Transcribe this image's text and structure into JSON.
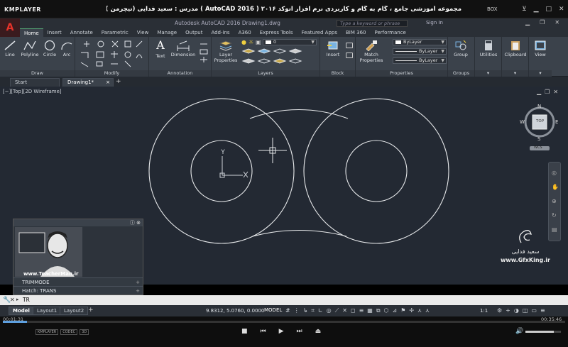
{
  "player": {
    "logo": "KMPLAYER",
    "title": "مجموعه آموزشی جامع ، گام به گام و کاربردی نرم افزار   اتوکد ۲۰۱۶ ( AutoCAD  2016 )  مدرس : سعید فدایی (تیچرمن ) گروه آموزشی پادشاه گرافیست ها",
    "box_label": "BOX",
    "time_elapsed": "00:01:31",
    "time_total": "00:35:46",
    "seek_fraction": 0.043,
    "volume_fraction": 0.8,
    "badges": [
      "KMPLAYER",
      "CODEC",
      "3D"
    ]
  },
  "app": {
    "title": "Autodesk AutoCAD 2016    Drawing1.dwg",
    "logo_letter": "A",
    "search_placeholder": "Type a keyword or phrase",
    "signin": "Sign In"
  },
  "ribbon_tabs": [
    "Home",
    "Insert",
    "Annotate",
    "Parametric",
    "View",
    "Manage",
    "Output",
    "Add-ins",
    "A360",
    "Express Tools",
    "Featured Apps",
    "BIM 360",
    "Performance"
  ],
  "active_tab": "Home",
  "panels": {
    "draw": {
      "label": "Draw",
      "tools": [
        "Line",
        "Polyline",
        "Circle",
        "Arc"
      ]
    },
    "modify": {
      "label": "Modify"
    },
    "annotation": {
      "label": "Annotation",
      "tools": [
        "Text",
        "Dimension"
      ]
    },
    "layers": {
      "label": "Layers",
      "tool": "Layer\nProperties",
      "layer_value": "0"
    },
    "block": {
      "label": "Block",
      "tool": "Insert"
    },
    "properties": {
      "label": "Properties",
      "tool": "Match\nProperties",
      "bylayer_1": "ByLayer",
      "bylayer_2": "ByLayer",
      "bylayer_3": "ByLayer"
    },
    "groups": {
      "label": "Groups",
      "tool": "Group"
    },
    "utilities": {
      "tool": "Utilities"
    },
    "clipboard": {
      "tool": "Clipboard"
    },
    "view": {
      "tool": "View"
    }
  },
  "file_tabs": [
    {
      "label": "Start"
    },
    {
      "label": "Drawing1*"
    }
  ],
  "viewport": {
    "label": "[−][Top][2D Wireframe]",
    "navcube": {
      "top": "TOP",
      "n": "N",
      "s": "S",
      "e": "E",
      "w": "W",
      "wcs": "WCS"
    },
    "ucs_y": "Y",
    "ucs_x": "X"
  },
  "watermark": {
    "name": "سعید فدایی",
    "site": "www.GfxKing.ir"
  },
  "presenter": {
    "website": "www.TeacherMan.ir"
  },
  "command_history": [
    {
      "label": "TRIMMODE"
    },
    {
      "label": "Hatch: TRANS"
    }
  ],
  "command_input": "TR",
  "status": {
    "layout_tabs": [
      "Model",
      "Layout1",
      "Layout2"
    ],
    "coords": "9.8312, 5.0760, 0.0000",
    "model": "MODEL",
    "scale": "1:1"
  },
  "colors": {
    "viewport_bg": "#232933",
    "ribbon_bg": "#3b424b",
    "accent": "#e8332a"
  }
}
